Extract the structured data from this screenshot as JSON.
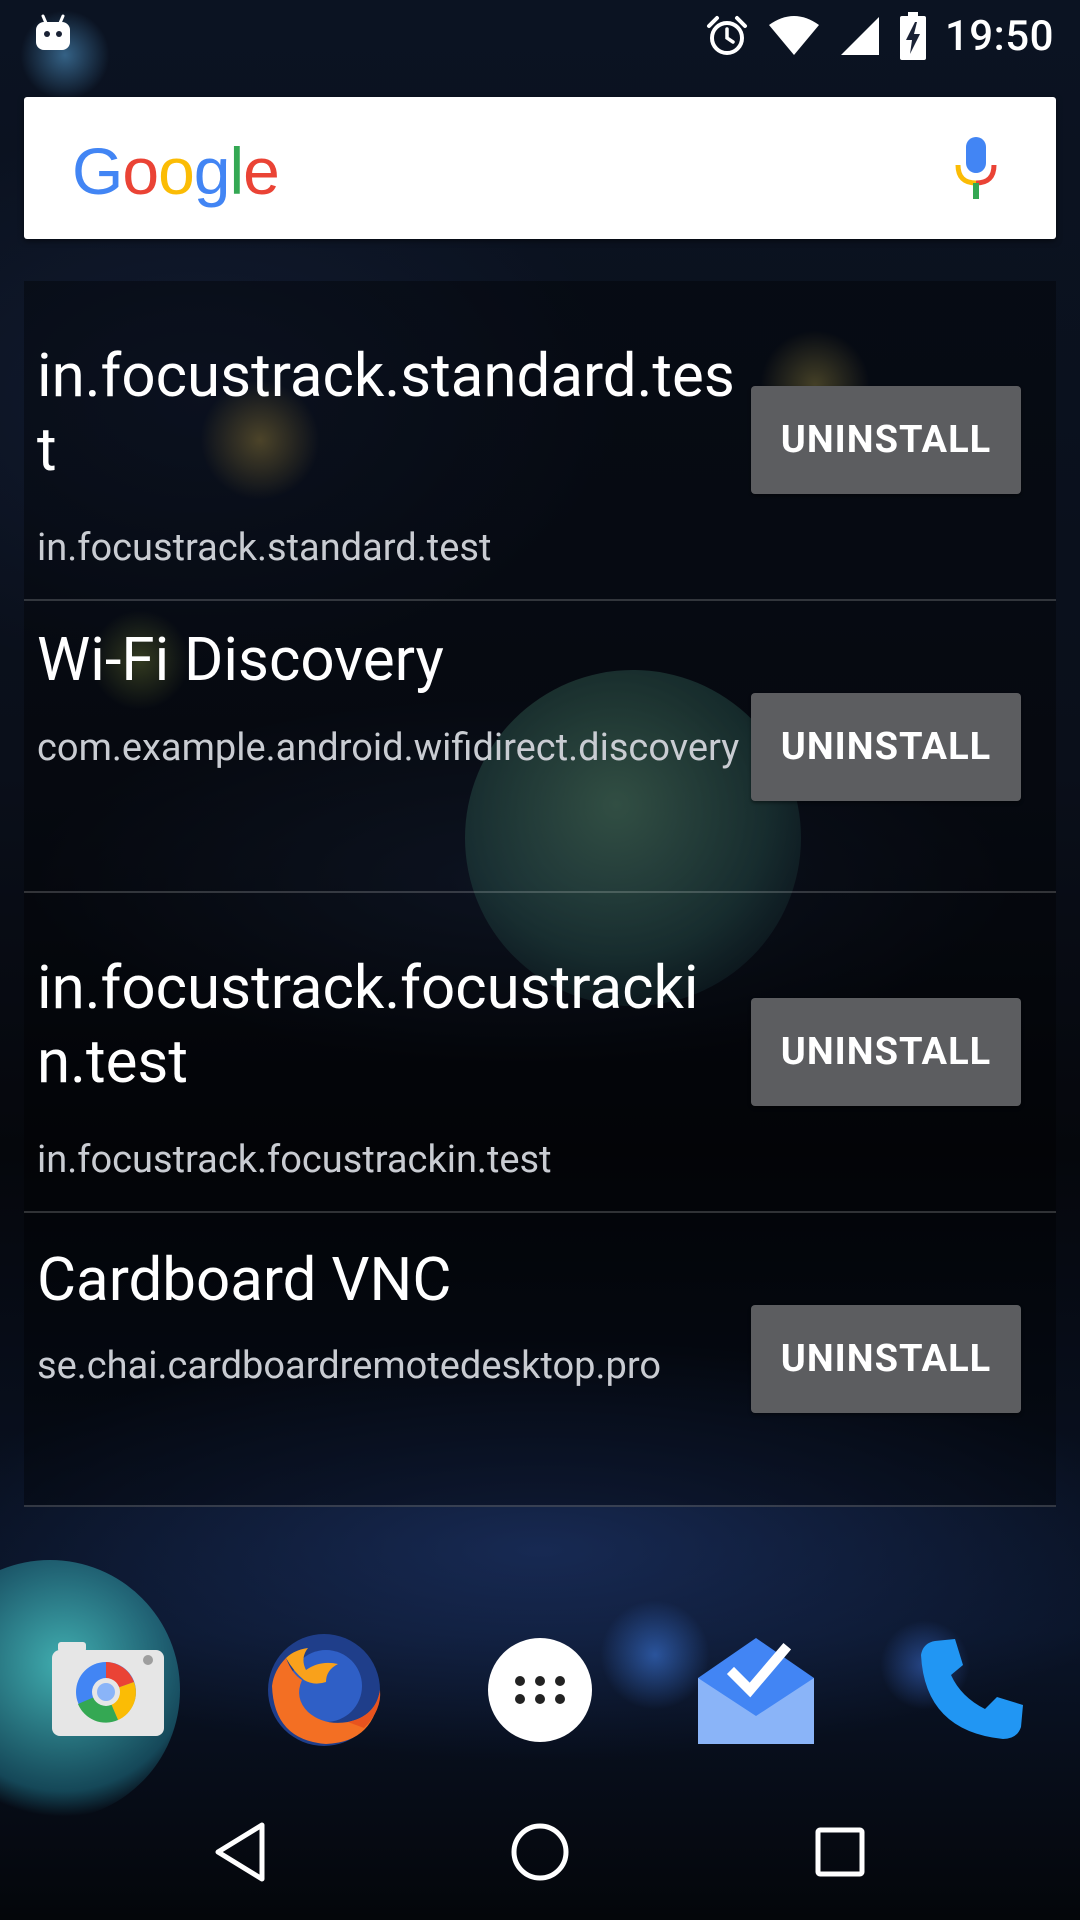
{
  "status_bar": {
    "time": "19:50",
    "icons": [
      "android-notification-icon",
      "alarm-icon",
      "wifi-icon",
      "signal-icon",
      "battery-charging-icon"
    ]
  },
  "search_bar": {
    "logo_text": "Google",
    "logo_colors": [
      "#4285F4",
      "#EA4335",
      "#FBBC05",
      "#4285F4",
      "#34A853",
      "#EA4335"
    ],
    "mic_icon": "mic-icon"
  },
  "apps": [
    {
      "name": "in.focustrack.standard.test",
      "package": "in.focustrack.standard.test",
      "button": "UNINSTALL"
    },
    {
      "name": "Wi-Fi Discovery",
      "package": "com.example.android.wifidirect.discovery",
      "button": "UNINSTALL"
    },
    {
      "name": "in.focustrack.focustrackin.test",
      "package": "in.focustrack.focustrackin.test",
      "button": "UNINSTALL"
    },
    {
      "name": "Cardboard VNC",
      "package": "se.chai.cardboardremotedesktop.pro",
      "button": "UNINSTALL"
    }
  ],
  "dock": [
    "camera-icon",
    "firefox-icon",
    "app-drawer-icon",
    "inbox-icon",
    "phone-icon"
  ],
  "nav_bar": [
    "back-icon",
    "home-icon",
    "recents-icon"
  ],
  "colors": {
    "button_bg": "#5c5d60",
    "package_text": "#c9ccd2"
  }
}
